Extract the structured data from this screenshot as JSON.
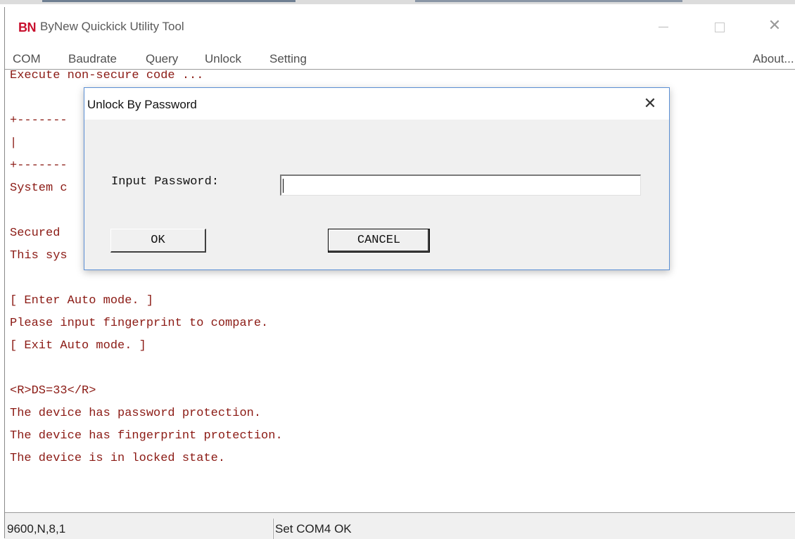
{
  "app": {
    "logo": "BN",
    "title": "ByNew Quickick Utility Tool",
    "window_controls": {
      "minimize": "—",
      "close": "✕"
    }
  },
  "menu": {
    "com": "COM",
    "baudrate": "Baudrate",
    "query": "Query",
    "unlock": "Unlock",
    "setting": "Setting",
    "about": "About..."
  },
  "console": {
    "lines": [
      "Execute non-secure code ...",
      "",
      "+-------",
      "|",
      "+-------",
      "System c",
      "",
      "Secured ",
      "This sys",
      "",
      "[ Enter Auto mode. ]",
      "Please input fingerprint to compare.",
      "[ Exit Auto mode. ]",
      "",
      "<R>DS=33</R>",
      "The device has password protection.",
      "The device has fingerprint protection.",
      "The device is in locked state."
    ],
    "text_color": "#8b1a14"
  },
  "dialog": {
    "title": "Unlock By Password",
    "close": "✕",
    "password_label": "Input Password:",
    "password_value": "",
    "ok_label": "OK",
    "cancel_label": "CANCEL"
  },
  "status": {
    "serial_config": "9600,N,8,1",
    "message": "Set COM4 OK"
  }
}
